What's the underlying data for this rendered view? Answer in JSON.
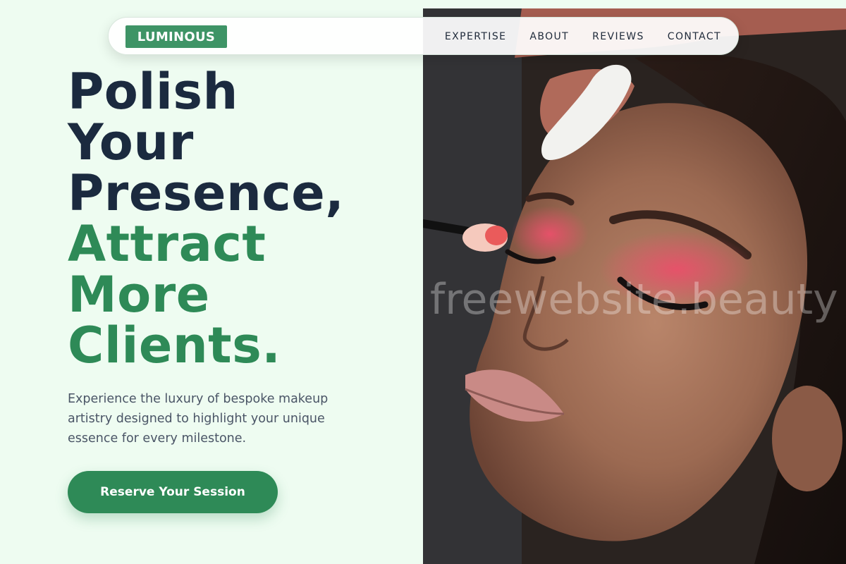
{
  "brand": {
    "logo_text": "LUMINOUS",
    "accent": "#3e9466"
  },
  "nav": {
    "items": [
      {
        "label": "EXPERTISE"
      },
      {
        "label": "ABOUT"
      },
      {
        "label": "REVIEWS"
      },
      {
        "label": "CONTACT"
      }
    ]
  },
  "hero": {
    "headline_dark": [
      "Polish",
      "Your",
      "Presence,"
    ],
    "headline_green": [
      "Attract",
      "More",
      "Clients."
    ],
    "subtext": "Experience the luxury of bespoke makeup artistry designed to highlight your unique essence for every milestone.",
    "cta_label": "Reserve Your Session",
    "headline_dark_color": "#1b2a3f",
    "headline_green_color": "#2e8a57"
  },
  "photo": {
    "subject": "makeup artist applying pink eyeshadow and mascara to a woman with closed eyes",
    "watermark": "freewebsite.beauty"
  }
}
